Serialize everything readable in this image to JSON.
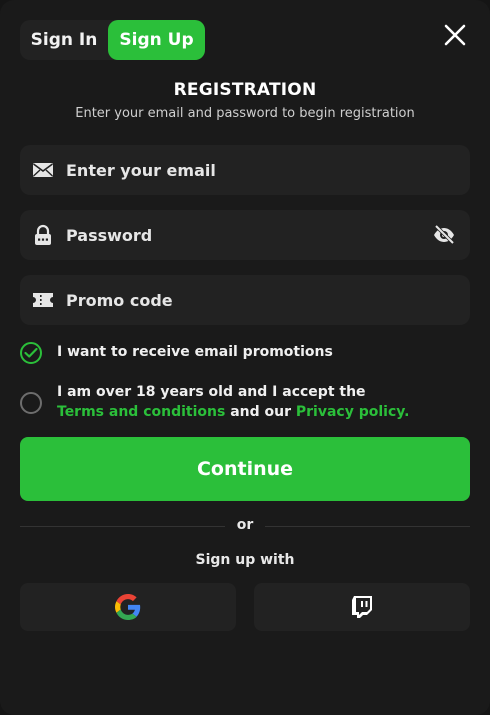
{
  "tabs": {
    "signin": "Sign In",
    "signup": "Sign Up",
    "active": "signup"
  },
  "header": {
    "title": "REGISTRATION",
    "subtitle": "Enter your email and password to begin registration"
  },
  "fields": {
    "email_placeholder": "Enter your email",
    "password_placeholder": "Password",
    "promo_placeholder": "Promo code"
  },
  "checks": {
    "promotions": {
      "label": "I want to receive email promotions",
      "checked": true
    },
    "terms": {
      "prefix": "I am over 18 years old and I accept the",
      "terms_link": "Terms and conditions",
      "middle": "and our",
      "privacy_link": "Privacy policy.",
      "checked": false
    }
  },
  "actions": {
    "continue_label": "Continue",
    "or_label": "or",
    "signup_with_label": "Sign up with"
  },
  "social": [
    {
      "name": "google",
      "icon": "google-icon"
    },
    {
      "name": "twitch",
      "icon": "twitch-icon"
    }
  ],
  "colors": {
    "accent": "#2bbf3a",
    "background": "#1a1a1a",
    "field": "#222222"
  }
}
